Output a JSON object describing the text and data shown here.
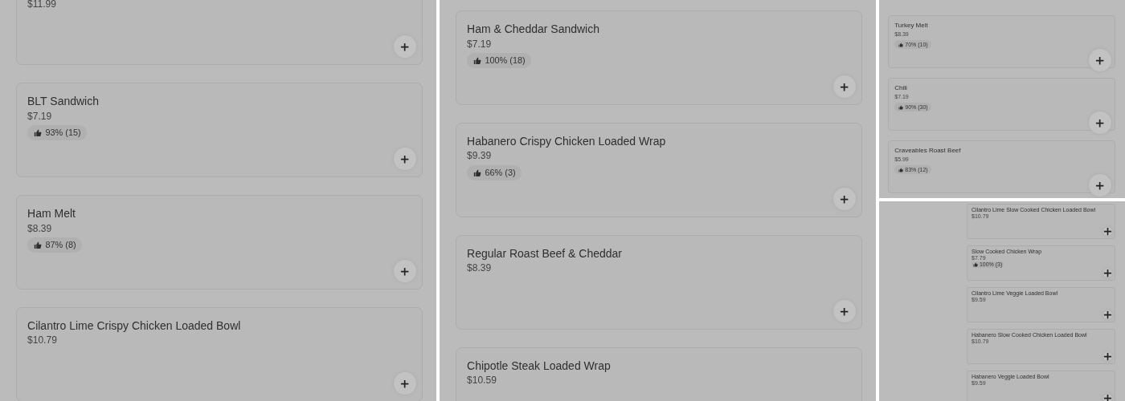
{
  "panels": [
    {
      "items": [
        {
          "price": "$11.99"
        },
        {
          "name": "BLT Sandwich",
          "price": "$7.19",
          "rating": "93% (15)"
        },
        {
          "name": "Ham Melt",
          "price": "$8.39",
          "rating": "87% (8)"
        },
        {
          "name": "Cilantro Lime Crispy Chicken Loaded Bowl",
          "price": "$10.79"
        }
      ]
    },
    {
      "items": [
        {
          "name": "Ham & Cheddar Sandwich",
          "price": "$7.19",
          "rating": "100% (18)"
        },
        {
          "name": "Habanero Crispy Chicken Loaded Wrap",
          "price": "$9.39",
          "rating": "66% (3)"
        },
        {
          "name": "Regular Roast Beef & Cheddar",
          "price": "$8.39"
        },
        {
          "name": "Chipotle Steak Loaded Wrap",
          "price": "$10.59",
          "add_button": false
        }
      ]
    },
    {
      "items": [
        {
          "name": "Turkey Melt",
          "price": "$8.39",
          "rating": "70% (10)"
        },
        {
          "name": "Chili",
          "price": "$7.19",
          "rating": "90% (30)"
        },
        {
          "name": "Craveables Roast Beef",
          "price": "$5.99",
          "rating": "83% (12)"
        }
      ]
    },
    {
      "items": [
        {
          "name": "Cilantro Lime Slow Cooked Chicken Loaded Bowl",
          "price": "$10.79"
        },
        {
          "name": "Slow Cooked Chicken Wrap",
          "price": "$7.79",
          "rating": "100% (3)"
        },
        {
          "name": "Cilantro Lime Veggie Loaded Bowl",
          "price": "$9.59"
        },
        {
          "name": "Habanero Slow Cooked Chicken Loaded Bowl",
          "price": "$10.79"
        },
        {
          "name": "Habanero Veggie Loaded Bowl",
          "price": "$9.59"
        }
      ]
    }
  ]
}
